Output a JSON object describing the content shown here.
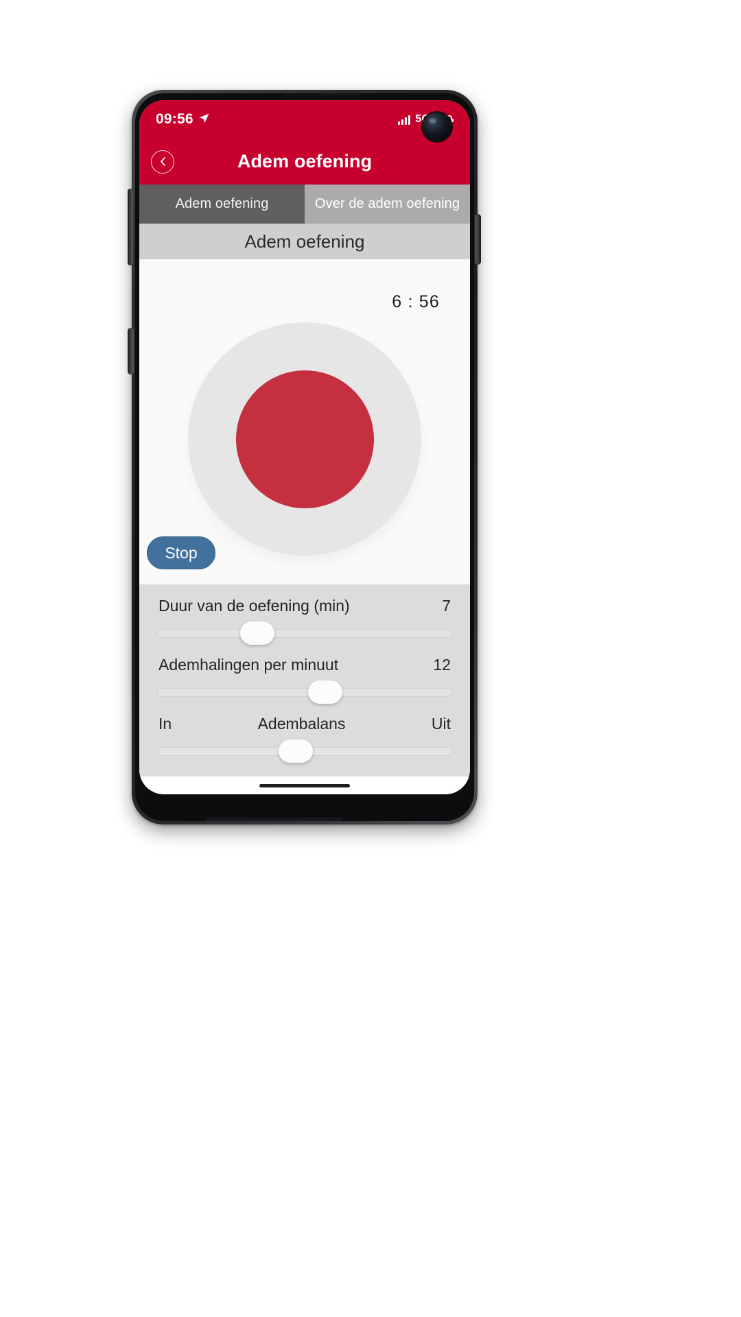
{
  "status_bar": {
    "time": "09:56",
    "location_icon": "location-arrow-icon",
    "signal_icon": "cellular-signal-icon",
    "network_label": "5G",
    "battery_icon": "battery-icon"
  },
  "app_bar": {
    "back_icon": "chevron-left-icon",
    "title": "Adem oefening"
  },
  "tabs": [
    {
      "label": "Adem oefening",
      "active": true
    },
    {
      "label": "Over de adem oefening",
      "active": false
    }
  ],
  "section_header": {
    "title": "Adem oefening"
  },
  "exercise": {
    "timer": "6 : 56",
    "breath_circle_icon": "breathing-circle",
    "stop_label": "Stop"
  },
  "controls": {
    "duration": {
      "label": "Duur van de oefening (min)",
      "value": "7",
      "thumb_percent": 34
    },
    "breaths": {
      "label": "Ademhalingen per minuut",
      "value": "12",
      "thumb_percent": 57
    },
    "balance": {
      "left_label": "In",
      "center_label": "Adembalans",
      "right_label": "Uit",
      "thumb_percent": 47
    }
  },
  "colors": {
    "brand_red": "#c8002e",
    "circle_red": "#c4303f",
    "stop_blue": "#41719c",
    "tab_active": "#5f5f5f",
    "tab_inactive": "#ababab",
    "section_bg": "#cfcfcf",
    "controls_bg": "#dcdcdc"
  },
  "nav": {
    "gesture_pill": "gesture-nav-pill"
  }
}
